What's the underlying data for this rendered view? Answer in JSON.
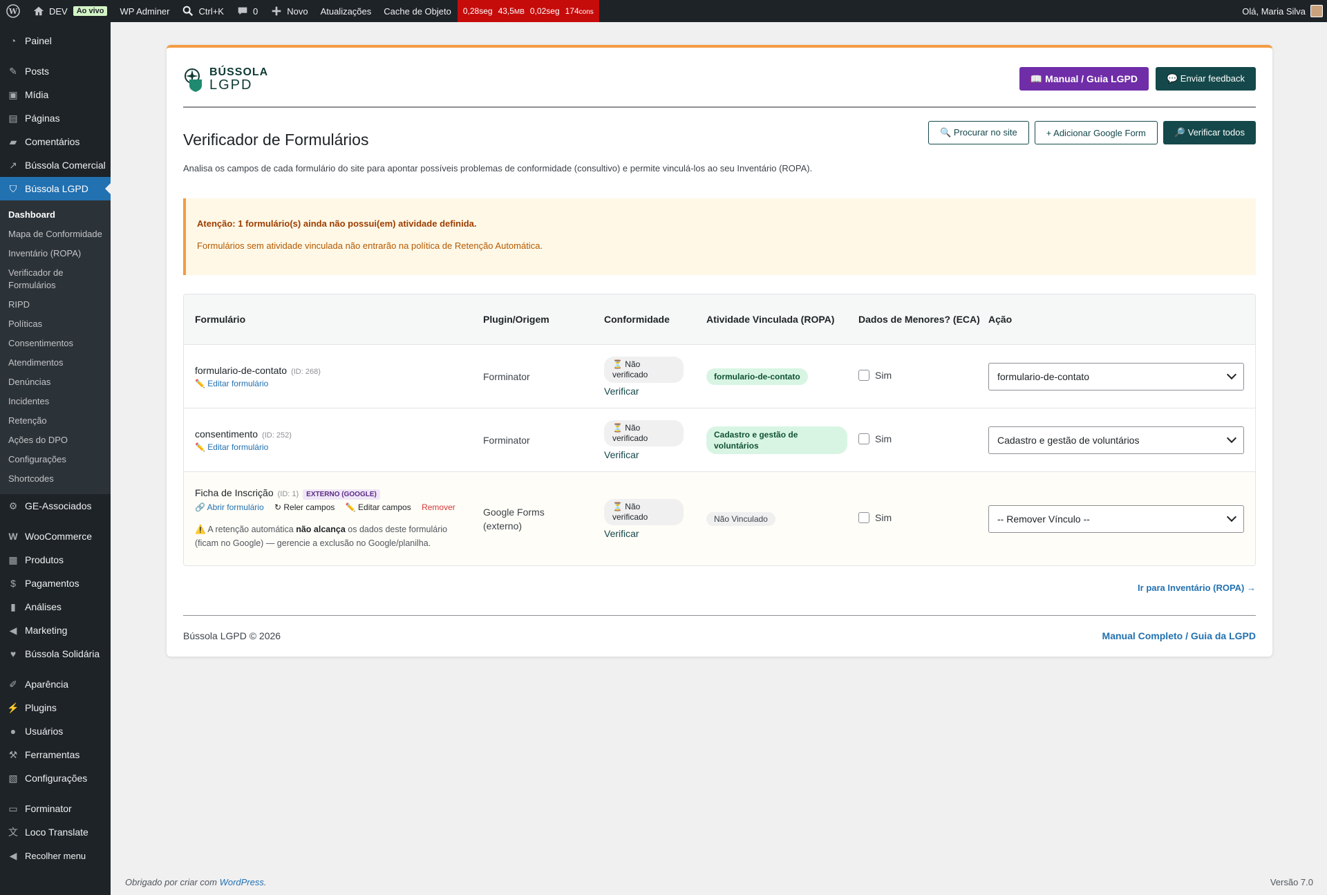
{
  "adminbar": {
    "site": "DEV",
    "live": "Ao vivo",
    "adminer": "WP Adminer",
    "search_shortcut": "Ctrl+K",
    "comments_count": "0",
    "new": "Novo",
    "updates": "Atualizações",
    "object_cache": "Cache de Objeto",
    "qm": {
      "time": "0,28seg",
      "memory": "43,5",
      "memory_unit": "MB",
      "db_time": "0,02seg",
      "queries": "174",
      "queries_unit": "cons"
    },
    "greeting": "Olá, Maria Silva"
  },
  "sidebar": {
    "top": [
      {
        "label": "Painel",
        "icon": "dashboard-icon"
      }
    ],
    "group1": [
      {
        "label": "Posts",
        "icon": "pin-icon"
      },
      {
        "label": "Mídia",
        "icon": "media-icon"
      },
      {
        "label": "Páginas",
        "icon": "pages-icon"
      },
      {
        "label": "Comentários",
        "icon": "comment-icon"
      },
      {
        "label": "Bússola Comercial",
        "icon": "chart-icon"
      },
      {
        "label": "Bússola LGPD",
        "icon": "shield-icon"
      }
    ],
    "submenu": [
      "Dashboard",
      "Mapa de Conformidade",
      "Inventário (ROPA)",
      "Verificador de Formulários",
      "RIPD",
      "Políticas",
      "Consentimentos",
      "Atendimentos",
      "Denúncias",
      "Incidentes",
      "Retenção",
      "Ações do DPO",
      "Configurações",
      "Shortcodes"
    ],
    "group2": [
      {
        "label": "GE-Associados",
        "icon": "gear-icon"
      }
    ],
    "group3": [
      {
        "label": "WooCommerce",
        "icon": "woo-icon"
      },
      {
        "label": "Produtos",
        "icon": "archive-icon"
      },
      {
        "label": "Pagamentos",
        "icon": "dollar-icon"
      },
      {
        "label": "Análises",
        "icon": "bar-chart-icon"
      },
      {
        "label": "Marketing",
        "icon": "megaphone-icon"
      },
      {
        "label": "Bússola Solidária",
        "icon": "heart-icon"
      }
    ],
    "group4": [
      {
        "label": "Aparência",
        "icon": "brush-icon"
      },
      {
        "label": "Plugins",
        "icon": "plug-icon"
      },
      {
        "label": "Usuários",
        "icon": "user-icon"
      },
      {
        "label": "Ferramentas",
        "icon": "wrench-icon"
      },
      {
        "label": "Configurações",
        "icon": "settings-icon"
      }
    ],
    "group5": [
      {
        "label": "Forminator",
        "icon": "form-icon"
      },
      {
        "label": "Loco Translate",
        "icon": "translate-icon"
      },
      {
        "label": "Recolher menu",
        "icon": "collapse-icon"
      }
    ]
  },
  "brand": {
    "line1": "BÚSSOLA",
    "line2": "LGPD"
  },
  "top_actions": {
    "manual": "📖 Manual / Guia LGPD",
    "feedback": "💬 Enviar feedback"
  },
  "page": {
    "title": "Verificador de Formulários",
    "description": "Analisa os campos de cada formulário do site para apontar possíveis problemas de conformidade (consultivo) e permite vinculá-los ao seu Inventário (ROPA).",
    "actions": {
      "search": "🔍 Procurar no site",
      "add_google": "+ Adicionar Google Form",
      "verify_all": "🔎 Verificar todos"
    }
  },
  "notice": {
    "title": "Atenção: 1 formulário(s) ainda não possui(em) atividade definida.",
    "body": "Formulários sem atividade vinculada não entrarão na política de Retenção Automática."
  },
  "table": {
    "headers": [
      "Formulário",
      "Plugin/Origem",
      "Conformidade",
      "Atividade Vinculada (ROPA)",
      "Dados de Menores? (ECA)",
      "Ação"
    ],
    "rows": [
      {
        "name": "formulario-de-contato",
        "id": "(ID: 268)",
        "edit": "✏️ Editar formulário",
        "plugin": "Forminator",
        "status": "⏳ Não verificado",
        "verify": "Verificar",
        "activity": "formulario-de-contato",
        "minors": "Sim",
        "select": "formulario-de-contato"
      },
      {
        "name": "consentimento",
        "id": "(ID: 252)",
        "edit": "✏️ Editar formulário",
        "plugin": "Forminator",
        "status": "⏳ Não verificado",
        "verify": "Verificar",
        "activity": "Cadastro e gestão de voluntários",
        "minors": "Sim",
        "select": "Cadastro e gestão de voluntários"
      },
      {
        "name": "Ficha de Inscrição",
        "id": "(ID: 1)",
        "badge": "EXTERNO (GOOGLE)",
        "open": "🔗 Abrir formulário",
        "reread": "↻ Reler campos",
        "edit_fields": "✏️ Editar campos",
        "remove": "Remover",
        "warn_pre": "⚠️ A retenção automática ",
        "warn_bold": "não alcança",
        "warn_post": " os dados deste formulário (ficam no Google) — gerencie a exclusão no Google/planilha.",
        "plugin": "Google Forms (externo)",
        "status": "⏳ Não verificado",
        "verify": "Verificar",
        "activity": "Não Vinculado",
        "minors": "Sim",
        "select": "-- Remover Vínculo --"
      }
    ]
  },
  "ropa_link": "Ir para Inventário (ROPA) →",
  "footer": {
    "left": "Bússola LGPD © 2026",
    "right": "Manual Completo / Guia da LGPD"
  },
  "wpfooter": {
    "thanks": "Obrigado por criar com ",
    "wp": "WordPress",
    "dot": ".",
    "version": "Versão 7.0"
  },
  "colors": {
    "accent_orange": "#f39c44",
    "brand_teal": "#15484a",
    "purple": "#6f2da8",
    "wp_blue": "#2271b1"
  }
}
